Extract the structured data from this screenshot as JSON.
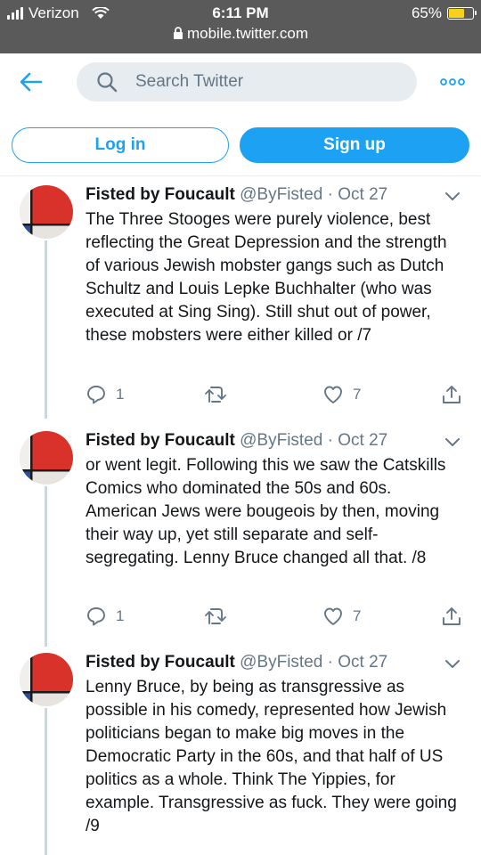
{
  "status_bar": {
    "carrier": "Verizon",
    "time": "6:11 PM",
    "url": "mobile.twitter.com",
    "battery": "65%",
    "battery_level": 0.65
  },
  "header": {
    "search_placeholder": "Search Twitter"
  },
  "auth": {
    "login_label": "Log in",
    "signup_label": "Sign up"
  },
  "colors": {
    "accent": "#1da1f2",
    "secondary_text": "#657786",
    "status_bar_bg": "#5a5a5a"
  },
  "tweets": [
    {
      "name": "Fisted by Foucault",
      "handle": "@ByFisted",
      "separator": "·",
      "date": "Oct 27",
      "text": "The Three Stooges were purely violence, best reflecting the Great Depression and the strength of various Jewish mobster gangs such as Dutch Schultz and Louis Lepke Buchhalter (who was executed at Sing Sing). Still shut out of power, these mobsters were either killed or /7",
      "replies": "1",
      "likes": "7"
    },
    {
      "name": "Fisted by Foucault",
      "handle": "@ByFisted",
      "separator": "·",
      "date": "Oct 27",
      "text": "or went legit.  Following this we saw the Catskills Comics who dominated the 50s and 60s.  American Jews were bougeois by then, moving their way up, yet still separate and self-segregating.  Lenny Bruce changed all that. /8",
      "replies": "1",
      "likes": "7"
    },
    {
      "name": "Fisted by Foucault",
      "handle": "@ByFisted",
      "separator": "·",
      "date": "Oct 27",
      "text": "Lenny Bruce, by being as transgressive as possible in his comedy, represented how Jewish politicians began to make big moves in the Democratic Party in the 60s, and that half of US politics as a whole.  Think The Yippies, for example.  Transgressive as fuck. They were going /9",
      "replies": "",
      "likes": ""
    }
  ]
}
